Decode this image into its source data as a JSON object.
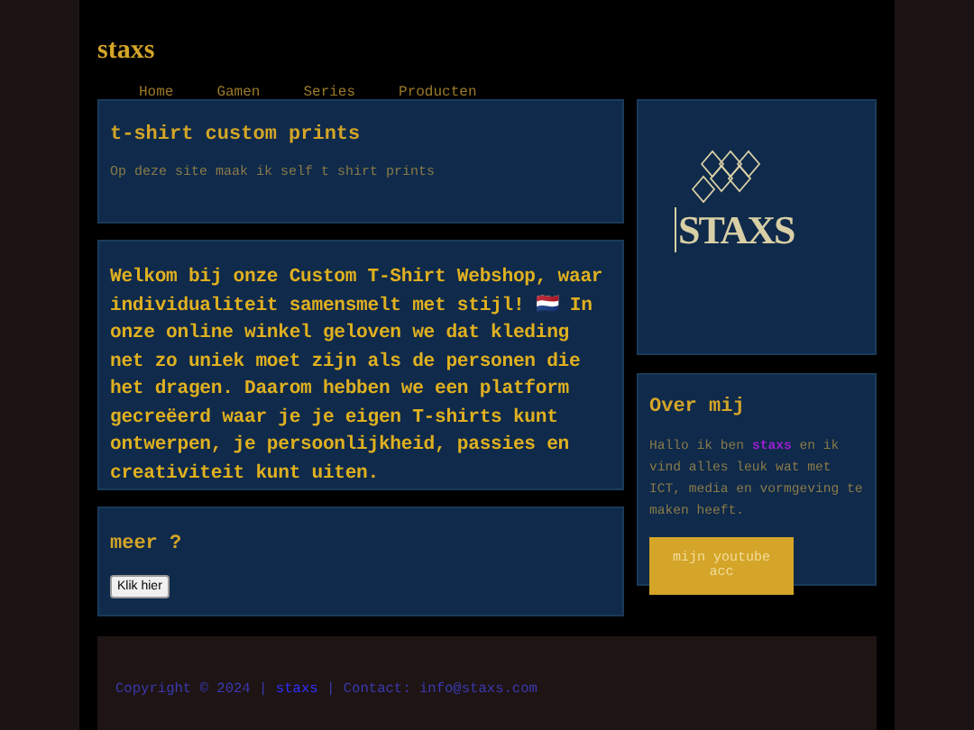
{
  "header": {
    "logo": "staxs",
    "nav": [
      {
        "label": "Home"
      },
      {
        "label": "Gamen"
      },
      {
        "label": "Series"
      },
      {
        "label": "Producten"
      }
    ]
  },
  "intro": {
    "title": "t-shirt custom prints",
    "text": "Op deze site maak ik self t shirt prints"
  },
  "welcome": {
    "text": "Welkom bij onze Custom T-Shirt Webshop, waar individualiteit samensmelt met stijl! 🇳🇱 In onze online winkel geloven we dat kleding net zo uniek moet zijn als de personen die het dragen. Daarom hebben we een platform gecreëerd waar je je eigen T-shirts kunt ontwerpen, je persoonlijkheid, passies en creativiteit kunt uiten."
  },
  "more": {
    "title": "meer ?",
    "button": "Klik hier"
  },
  "logo_card": {
    "wordmark": "STAXS"
  },
  "about": {
    "title": "Over mij",
    "text_before": "Hallo ik ben",
    "name": "staxs",
    "text_after": "en ik vind alles leuk wat met ICT, media en vormgeving te maken heeft.",
    "button": "mijn youtube acc"
  },
  "footer": {
    "copyright": "Copyright © 2024 |",
    "name": "staxs",
    "contact": "| Contact: info@staxs.com"
  }
}
